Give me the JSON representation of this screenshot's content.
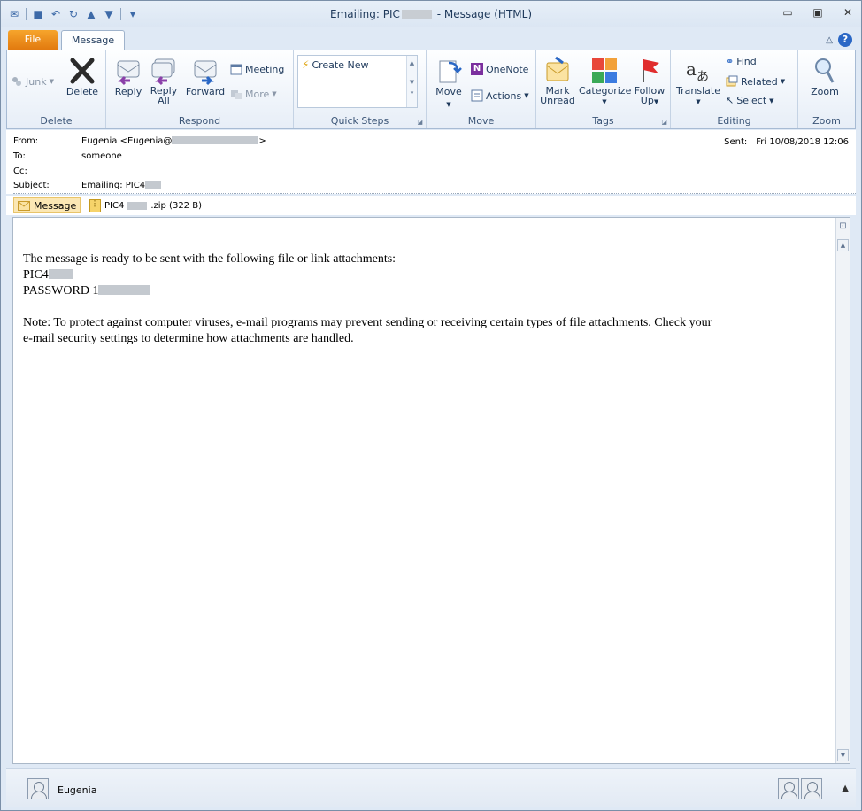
{
  "window": {
    "title_prefix": "Emailing: PIC",
    "title_suffix": " - Message (HTML)"
  },
  "quick_access": {
    "icons": [
      "mail-icon",
      "save-icon",
      "undo-icon",
      "redo-icon",
      "up-arrow-icon",
      "down-arrow-icon",
      "customize-icon"
    ]
  },
  "tabs": [
    {
      "label": "File"
    },
    {
      "label": "Message"
    }
  ],
  "ribbon": {
    "groups": {
      "delete": {
        "label": "Delete",
        "junk": "Junk",
        "delete": "Delete"
      },
      "respond": {
        "label": "Respond",
        "reply": "Reply",
        "reply_all_1": "Reply",
        "reply_all_2": "All",
        "forward": "Forward",
        "meeting": "Meeting",
        "more": "More"
      },
      "quick_steps": {
        "label": "Quick Steps",
        "create_new": "Create New"
      },
      "move": {
        "label": "Move",
        "move": "Move",
        "onenote": "OneNote",
        "actions": "Actions"
      },
      "tags": {
        "label": "Tags",
        "mark_unread_1": "Mark",
        "mark_unread_2": "Unread",
        "categorize": "Categorize",
        "follow_up_1": "Follow",
        "follow_up_2": "Up"
      },
      "editing": {
        "label": "Editing",
        "translate": "Translate",
        "find": "Find",
        "related": "Related",
        "select": "Select"
      },
      "zoom": {
        "label": "Zoom",
        "zoom": "Zoom"
      }
    }
  },
  "header": {
    "from_label": "From:",
    "from_value_prefix": "Eugenia <Eugenia@",
    "from_value_suffix": ">",
    "to_label": "To:",
    "to_value": "someone",
    "cc_label": "Cc:",
    "subject_label": "Subject:",
    "subject_value": "Emailing: PIC4",
    "sent_label": "Sent:",
    "sent_value": "Fri 10/08/2018 12:06"
  },
  "attachments": {
    "message_label": "Message",
    "file_prefix": "PIC4",
    "file_suffix": ".zip (322 B)"
  },
  "body": {
    "line1": "The message is ready to be sent with the following file or link attachments:",
    "line2": "PIC4",
    "line3": "PASSWORD 1",
    "note1": "Note: To protect against computer viruses, e-mail programs may prevent sending or receiving certain types of file attachments.  Check your",
    "note2": "e-mail security settings to determine how attachments are handled."
  },
  "people_pane": {
    "name": "Eugenia"
  },
  "colors": {
    "file_tab": "#e27a0f",
    "accent": "#2a67c5",
    "text": "#1e395b"
  }
}
